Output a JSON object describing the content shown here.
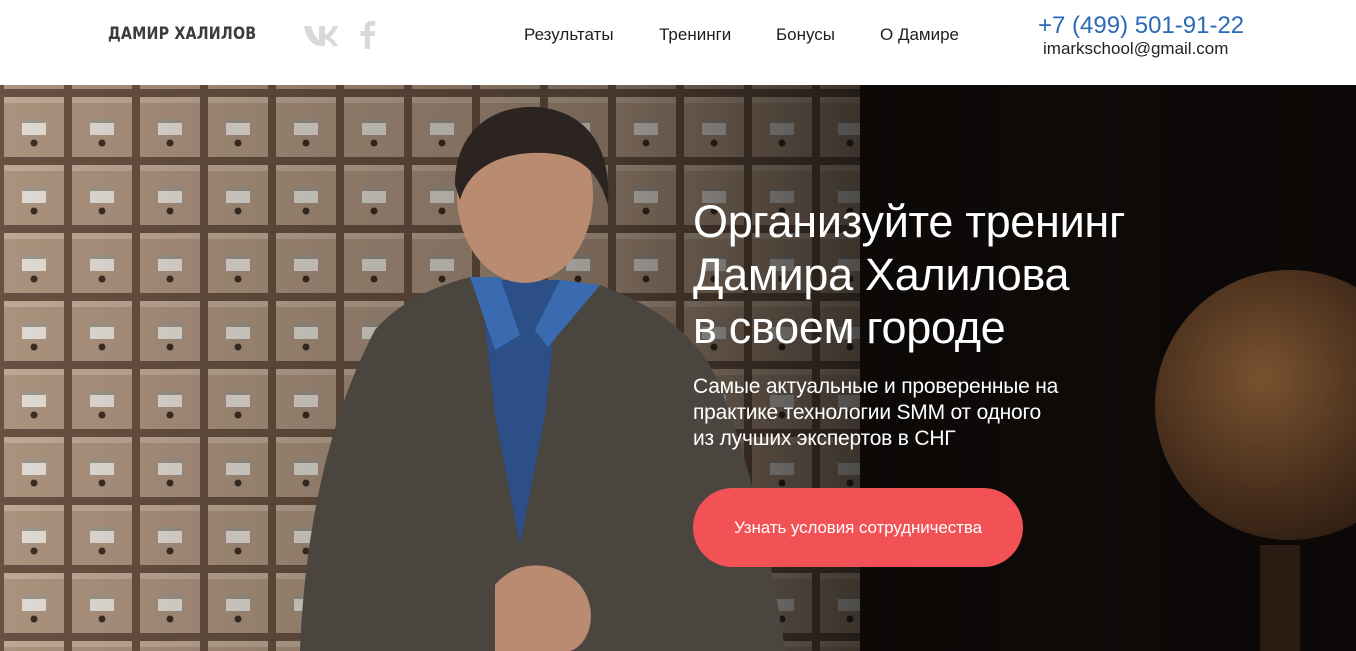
{
  "header": {
    "logo": "ДАМИР ХАЛИЛОВ",
    "social": [
      {
        "icon": "vk-icon",
        "color": "#d9d9d9"
      },
      {
        "icon": "facebook-icon",
        "color": "#d9d9d9"
      }
    ],
    "nav": [
      {
        "label": "Результаты"
      },
      {
        "label": "Тренинги"
      },
      {
        "label": "Бонусы"
      },
      {
        "label": "О Дамире"
      }
    ],
    "phone": "+7 (499) 501-91-22",
    "email": "imarkschool@gmail.com"
  },
  "hero": {
    "title_lines": [
      "Организуйте тренинг",
      "Дамира Халилова",
      "в своем городе"
    ],
    "subtitle_lines": [
      "Самые актуальные и проверенные на",
      "практике технологии SMM от одного",
      "из лучших экспертов в СНГ"
    ],
    "cta_label": "Узнать условия сотрудничества",
    "cta_color": "#f25255"
  },
  "colors": {
    "phone": "#2b69b7",
    "nav_text": "#1e1e1e",
    "hero_dark": "#1f1814"
  }
}
